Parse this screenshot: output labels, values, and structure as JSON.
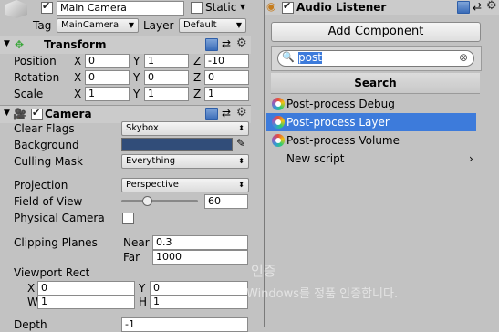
{
  "gameobject": {
    "name": "Main Camera",
    "static_label": "Static",
    "tag_label": "Tag",
    "tag_value": "MainCamera",
    "layer_label": "Layer",
    "layer_value": "Default"
  },
  "transform": {
    "title": "Transform",
    "position_label": "Position",
    "rotation_label": "Rotation",
    "scale_label": "Scale",
    "x": "X",
    "y": "Y",
    "z": "Z",
    "position": [
      "0",
      "1",
      "-10"
    ],
    "rotation": [
      "0",
      "0",
      "0"
    ],
    "scale": [
      "1",
      "1",
      "1"
    ]
  },
  "camera": {
    "title": "Camera",
    "clear_flags_label": "Clear Flags",
    "clear_flags_value": "Skybox",
    "background_label": "Background",
    "background_color": "#314d79",
    "culling_mask_label": "Culling Mask",
    "culling_mask_value": "Everything",
    "projection_label": "Projection",
    "projection_value": "Perspective",
    "fov_label": "Field of View",
    "fov_value": "60",
    "fov_fraction": 0.33,
    "physical_label": "Physical Camera",
    "clipping_label": "Clipping Planes",
    "near_label": "Near",
    "near_value": "0.3",
    "far_label": "Far",
    "far_value": "1000",
    "viewport_label": "Viewport Rect",
    "vp_x_label": "X",
    "vp_x": "0",
    "vp_y_label": "Y",
    "vp_y": "0",
    "vp_w_label": "W",
    "vp_w": "1",
    "vp_h_label": "H",
    "vp_h": "1",
    "depth_label": "Depth",
    "depth_value": "-1"
  },
  "audio_listener": {
    "title": "Audio Listener"
  },
  "popup": {
    "add_component_label": "Add Component",
    "search_value": "post",
    "search_header": "Search",
    "items": [
      {
        "label": "Post-process Debug"
      },
      {
        "label": "Post-process Layer"
      },
      {
        "label": "Post-process Volume"
      },
      {
        "label": "New script"
      }
    ],
    "selected_index": 1
  },
  "watermark": {
    "line1": "인증",
    "line2": "Windows를 정품 인증합니다."
  },
  "colors": {
    "selection": "#3d7bdb",
    "panel": "#c2c2c2"
  }
}
